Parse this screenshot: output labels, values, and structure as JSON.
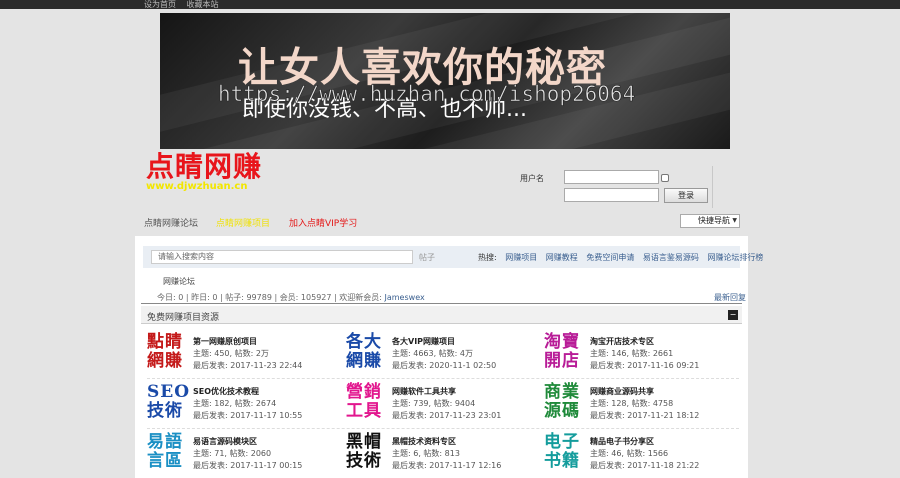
{
  "topbar": {
    "links": [
      "设为首页",
      "收藏本站"
    ]
  },
  "banner": {
    "title": "让女人喜欢你的秘密",
    "subtitle": "即使你没钱、不高、也不帅...",
    "watermark": "https://www.huzhan.com/ishop26064"
  },
  "logo": {
    "text": "点睛网赚",
    "url": "www.djwzhuan.cn"
  },
  "login": {
    "username_label": "用户名",
    "login_button": "登录"
  },
  "nav": {
    "items": [
      "点睛网赚论坛",
      "点睛网赚项目",
      "加入点睛VIP学习"
    ],
    "quick_nav": "快捷导航"
  },
  "search": {
    "placeholder": "请输入搜索内容",
    "button": "帖子",
    "hot_label": "热搜:",
    "hot_items": [
      "网赚项目",
      "网赚教程",
      "免费空间申请",
      "易语言鉴易源码",
      "网赚论坛排行榜"
    ]
  },
  "breadcrumb": "网赚论坛",
  "stats": {
    "today": "今日: 0",
    "yesterday": "昨日: 0",
    "posts": "帖子: 99789",
    "members": "会员: 105927",
    "newest_label": "欢迎新会员:",
    "newest_member": "Jameswex"
  },
  "newest_reply": "最新回复",
  "section": {
    "title": "免费网赚项目资源",
    "toggle": "−"
  },
  "forums": [
    {
      "icon_line1": "點睛",
      "icon_line2": "網賺",
      "icon_color": "#c41a1a",
      "name": "第一网赚原创项目",
      "counts": "主题: 450, 帖数: 2万",
      "last": "最后发表: 2017-11-23 22:44"
    },
    {
      "icon_line1": "各大",
      "icon_line2": "網賺",
      "icon_color": "#1a4aa8",
      "name": "各大VIP网赚项目",
      "counts": "主题: 4663, 帖数: 4万",
      "last": "最后发表: 2020-11-1 02:50"
    },
    {
      "icon_line1": "淘寶",
      "icon_line2": "開店",
      "icon_color": "#b81c97",
      "name": "淘宝开店技术专区",
      "counts": "主题: 146, 帖数: 2661",
      "last": "最后发表: 2017-11-16 09:21"
    },
    {
      "icon_line1": "SEO",
      "icon_line2": "技術",
      "icon_color": "#1a4aa8",
      "name": "SEO优化技术教程",
      "counts": "主题: 182, 帖数: 2674",
      "last": "最后发表: 2017-11-17 10:55"
    },
    {
      "icon_line1": "營銷",
      "icon_line2": "工具",
      "icon_color": "#e2168e",
      "name": "网赚软件工具共享",
      "counts": "主题: 739, 帖数: 9404",
      "last": "最后发表: 2017-11-23 23:01"
    },
    {
      "icon_line1": "商業",
      "icon_line2": "源碼",
      "icon_color": "#1f8a3a",
      "name": "网赚商业源码共享",
      "counts": "主题: 128, 帖数: 4758",
      "last": "最后发表: 2017-11-21 18:12"
    },
    {
      "icon_line1": "易語",
      "icon_line2": "言區",
      "icon_color": "#1a8fc4",
      "name": "易语言源码模块区",
      "counts": "主题: 71, 帖数: 2060",
      "last": "最后发表: 2017-11-17 00:15"
    },
    {
      "icon_line1": "黑帽",
      "icon_line2": "技術",
      "icon_color": "#111111",
      "name": "黑帽技术资料专区",
      "counts": "主题: 6, 帖数: 813",
      "last": "最后发表: 2017-11-17 12:16"
    },
    {
      "icon_line1": "电子",
      "icon_line2": "书籍",
      "icon_color": "#149c9c",
      "name": "精品电子书分享区",
      "counts": "主题: 46, 帖数: 1566",
      "last": "最后发表: 2017-11-18 21:22"
    }
  ]
}
